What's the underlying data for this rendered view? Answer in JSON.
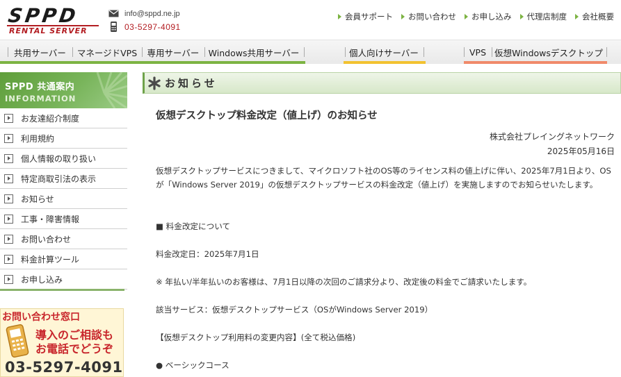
{
  "header": {
    "logo_main": "SPPD",
    "logo_sub": "RENTAL SERVER",
    "email": "info@sppd.ne.jp",
    "phone": "03-5297-4091",
    "links": [
      "会員サポート",
      "お問い合わせ",
      "お申し込み",
      "代理店制度",
      "会社概要"
    ]
  },
  "nav": {
    "items": [
      "共用サーバー",
      "マネージドVPS",
      "専用サーバー",
      "Windows共用サーバー",
      "個人向けサーバー",
      "VPS",
      "仮想Windowsデスクトップ"
    ],
    "bar_colors": [
      "#7cb342",
      "#f2c230",
      "#f08a6a"
    ]
  },
  "sidebar": {
    "title": "SPPD 共通案内",
    "subtitle": "INFORMATION",
    "items": [
      "お友達紹介制度",
      "利用規約",
      "個人情報の取り扱い",
      "特定商取引法の表示",
      "お知らせ",
      "工事・障害情報",
      "お問い合わせ",
      "料金計算ツール",
      "お申し込み"
    ],
    "inquiry": {
      "title": "お問い合わせ窓口",
      "line1": "導入のご相談も",
      "line2": "お電話でどうぞ",
      "phone": "03-5297-4091"
    }
  },
  "main": {
    "section_title": "お知らせ",
    "article": {
      "title": "仮想デスクトップ料金改定（値上げ）のお知らせ",
      "company": "株式会社プレイングネットワーク",
      "date": "2025年05月16日",
      "intro": "仮想デスクトップサービスにつきまして、マイクロソフト社のOS等のライセンス料の値上げに伴い、2025年7月1日より、OSが「Windows Server 2019」の仮想デスクトップサービスの料金改定（値上げ）を実施しますのでお知らせいたします。",
      "heading1": "■ 料金改定について",
      "effective": "料金改定日：2025年7月1日",
      "note": "※ 年払い/半年払いのお客様は、7月1日以降の次回のご請求分より、改定後の料金でご請求いたします。",
      "service": "該当サービス：仮想デスクトップサービス（OSがWindows Server 2019）",
      "price_heading": "【仮想デスクトップ利用料の変更内容】(全て税込価格)",
      "course": "● ベーシックコース"
    }
  },
  "colors": {
    "accent_green": "#7cb342",
    "accent_red": "#b31d22"
  }
}
